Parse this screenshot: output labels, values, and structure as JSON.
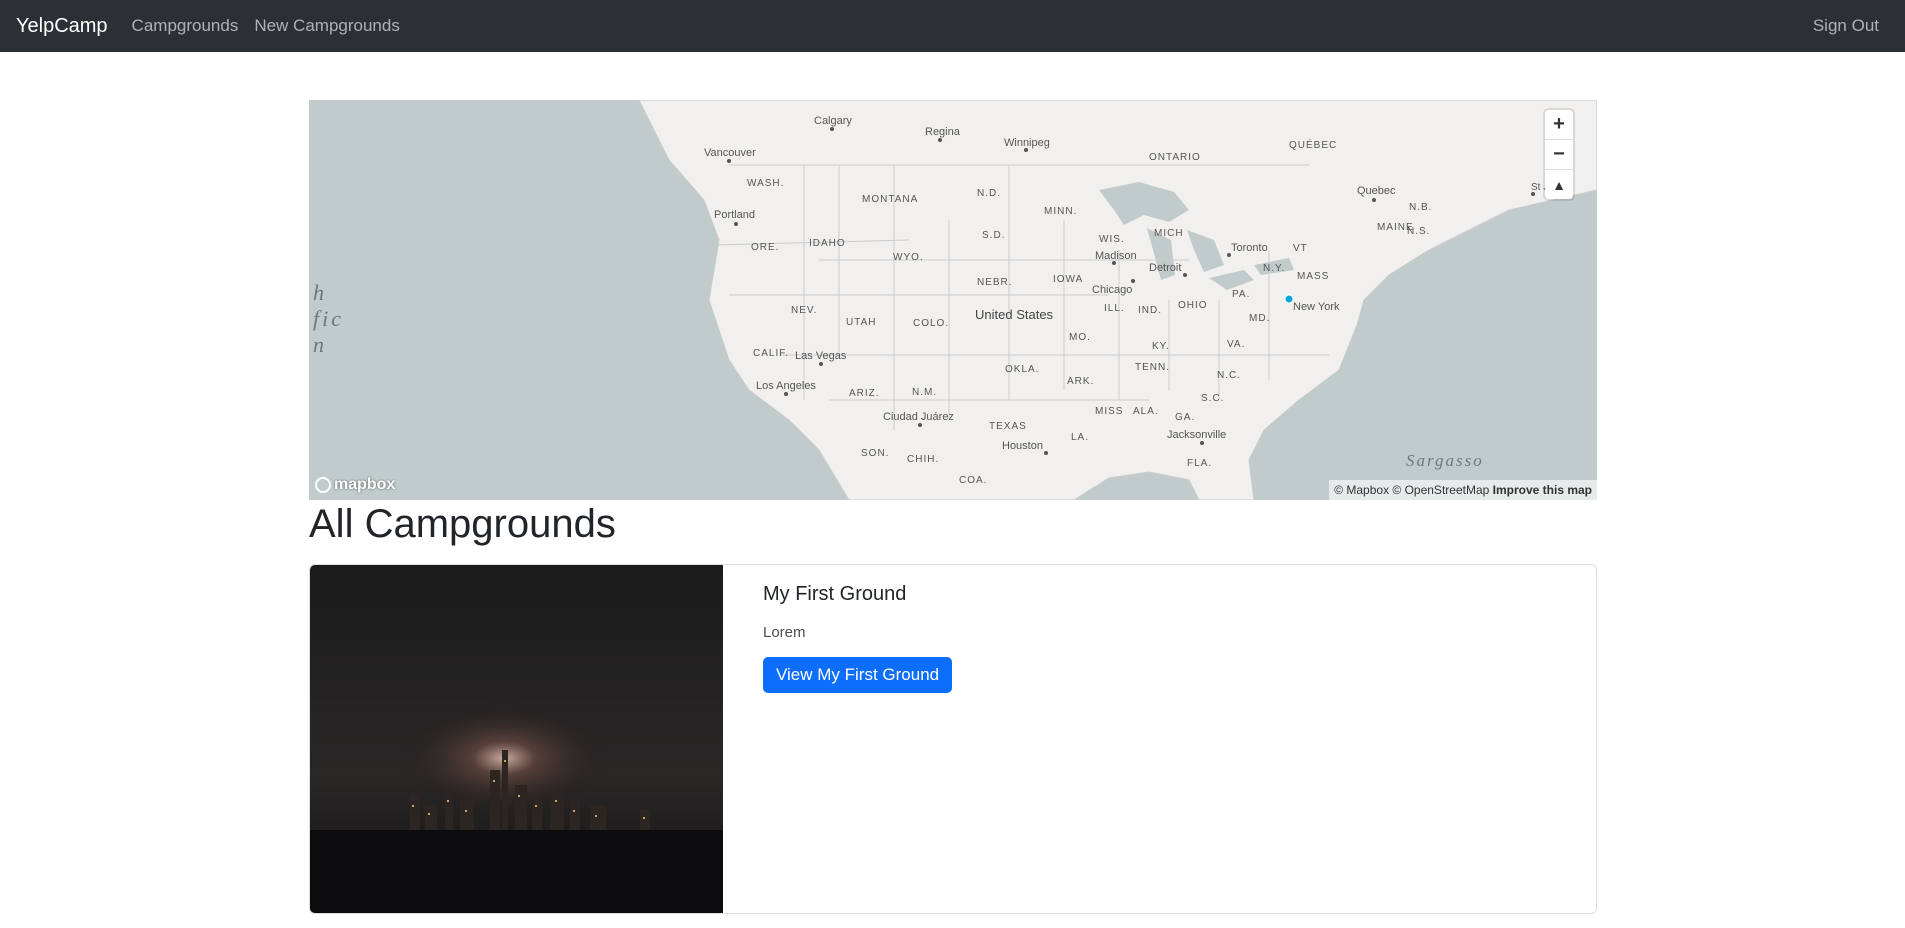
{
  "nav": {
    "brand": "YelpCamp",
    "links": [
      "Campgrounds",
      "New Campgrounds"
    ],
    "signout": "Sign Out"
  },
  "map": {
    "labels": {
      "calgary": "Calgary",
      "regina": "Regina",
      "winnipeg": "Winnipeg",
      "ontario": "ONTARIO",
      "quebec_prov": "QUÉBEC",
      "vancouver": "Vancouver",
      "wash": "WASH.",
      "montana": "MONTANA",
      "nd": "N.D.",
      "minn": "MINN.",
      "quebec": "Quebec",
      "portland": "Portland",
      "sd": "S.D.",
      "nb": "N.B.",
      "maine": "MAINE",
      "ns": "N.S.",
      "st": "St Jo",
      "ore": "ORE.",
      "idaho": "IDAHO",
      "wyo": "WYO.",
      "wis": "WIS.",
      "mich": "MICH",
      "toronto": "Toronto",
      "madison": "Madison",
      "detroit": "Detroit",
      "ny": "N.Y.",
      "vt": "VT",
      "mass": "MASS",
      "iowa": "IOWA",
      "nebr": "NEBR.",
      "chicago": "Chicago",
      "pa": "PA.",
      "nev": "NEV.",
      "utah": "UTAH",
      "colo": "COLO.",
      "us": "United States",
      "ill": "ILL.",
      "ind": "IND.",
      "ohio": "OHIO",
      "md": "MD.",
      "newyork": "New York",
      "mo": "MO.",
      "calif": "CALIF.",
      "lasvegas": "Las Vegas",
      "ky": "KY.",
      "va": "VA.",
      "okla": "OKLA.",
      "tenn": "TENN.",
      "nc": "N.C.",
      "losangeles": "Los Angeles",
      "ariz": "ARIZ.",
      "nm": "N.M.",
      "ark": "ARK.",
      "sc": "S.C.",
      "juarez": "Ciudad Juárez",
      "miss": "MISS",
      "ala": "ALA.",
      "ga": "GA.",
      "texas": "TEXAS",
      "jacksonville": "Jacksonville",
      "la": "LA.",
      "houston": "Houston",
      "son": "SON.",
      "chih": "CHIH.",
      "fla": "FLA.",
      "coa": "COA.",
      "sargasso": "Sargasso",
      "pacific1": "h",
      "pacific2": "fic",
      "pacific3": "n"
    },
    "zoom_in": "+",
    "zoom_out": "−",
    "compass": "▲",
    "logo": "mapbox",
    "attribution": "© Mapbox © OpenStreetMap",
    "improve": "Improve this map",
    "colors": {
      "water": "#c1cbcb",
      "land": "#f1f0ee",
      "marker": "#00a6e0"
    }
  },
  "heading": "All Campgrounds",
  "campground": {
    "title": "My First Ground",
    "description": "Lorem",
    "button": "View My First Ground"
  }
}
